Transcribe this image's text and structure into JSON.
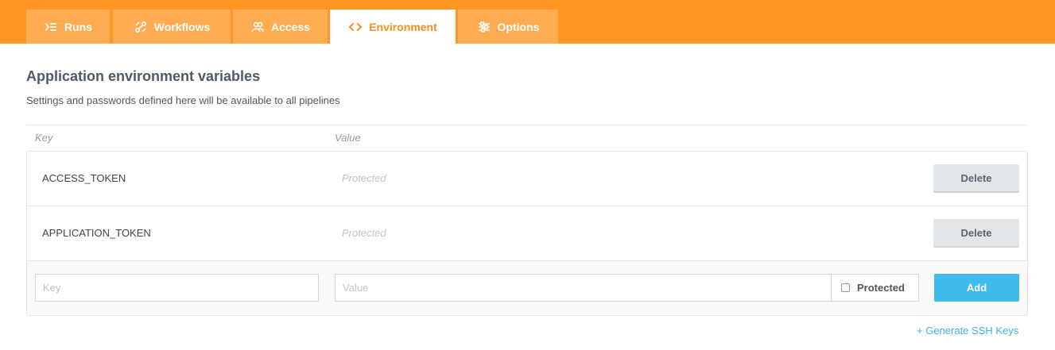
{
  "tabs": [
    {
      "label": "Runs",
      "icon": "runs-icon"
    },
    {
      "label": "Workflows",
      "icon": "workflows-icon"
    },
    {
      "label": "Access",
      "icon": "access-icon"
    },
    {
      "label": "Environment",
      "icon": "code-brackets-icon",
      "active": true
    },
    {
      "label": "Options",
      "icon": "sliders-icon"
    }
  ],
  "section": {
    "title": "Application environment variables",
    "subtitle": "Settings and passwords defined here will be available to all pipelines"
  },
  "columns": {
    "key": "Key",
    "value": "Value"
  },
  "variables": [
    {
      "key": "ACCESS_TOKEN",
      "value": "Protected",
      "action": "Delete"
    },
    {
      "key": "APPLICATION_TOKEN",
      "value": "Protected",
      "action": "Delete"
    }
  ],
  "new_var": {
    "key_placeholder": "Key",
    "value_placeholder": "Value",
    "protected_label": "Protected",
    "add_label": "Add"
  },
  "generate_ssh": "+ Generate SSH Keys",
  "colors": {
    "brand": "#ff9522",
    "accent": "#3fbcec"
  }
}
